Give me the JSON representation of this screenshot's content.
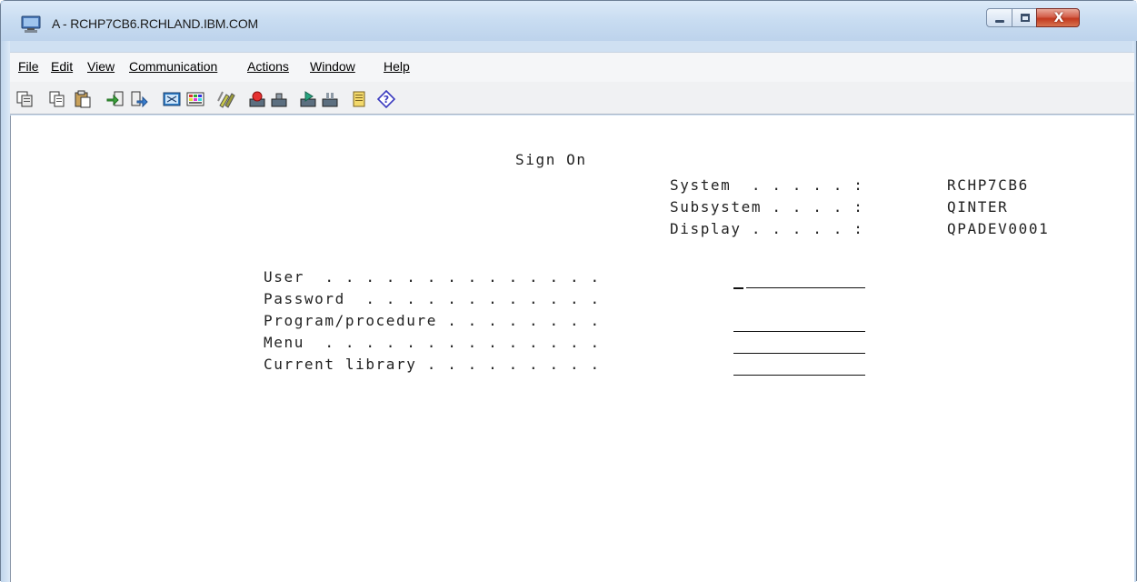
{
  "window": {
    "title": "A - RCHP7CB6.RCHLAND.IBM.COM",
    "close_label": "X",
    "colors": {
      "titlebar": "#c8dcf1",
      "close": "#c3391f",
      "screen_bg": "#ffffff"
    }
  },
  "menu": [
    {
      "label": "File"
    },
    {
      "label": "Edit"
    },
    {
      "label": "View"
    },
    {
      "label": "Communication"
    },
    {
      "label": "Actions"
    },
    {
      "label": "Window"
    },
    {
      "label": "Help"
    }
  ],
  "toolbar_icons": [
    "copy-icon",
    "copy-append-icon",
    "paste-icon",
    "send-icon",
    "receive-icon",
    "display-icon",
    "color-map-icon",
    "keyboard-map-icon",
    "record-macro-icon",
    "stop-macro-icon",
    "play-macro-icon",
    "pause-macro-icon",
    "notes-icon",
    "help-icon"
  ],
  "screen": {
    "heading": "Sign On",
    "system_info": [
      {
        "label": "System  . . . . . :",
        "value": "RCHP7CB6"
      },
      {
        "label": "Subsystem . . . . :",
        "value": "QINTER"
      },
      {
        "label": "Display . . . . . :",
        "value": "QPADEV0001"
      }
    ],
    "fields": [
      {
        "label": "User  . . . . . . . . . . . . . .",
        "value": ""
      },
      {
        "label": "Password  . . . . . . . . . . . .",
        "value": ""
      },
      {
        "label": "Program/procedure . . . . . . . .",
        "value": ""
      },
      {
        "label": "Menu  . . . . . . . . . . . . . .",
        "value": ""
      },
      {
        "label": "Current library . . . . . . . . .",
        "value": ""
      }
    ]
  }
}
